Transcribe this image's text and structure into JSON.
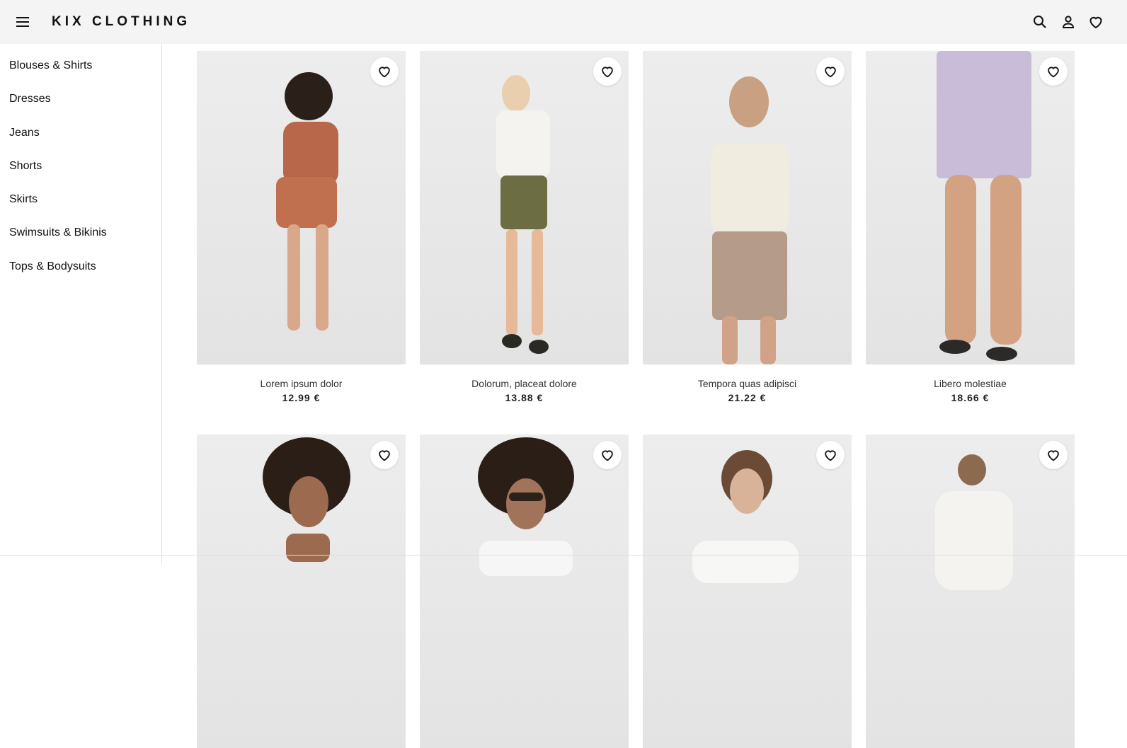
{
  "header": {
    "brand": "KIX CLOTHING",
    "icons": {
      "menu": "menu-icon",
      "search": "search-icon",
      "account": "account-icon",
      "wishlist": "heart-icon"
    }
  },
  "sidebar": {
    "items": [
      {
        "label": "Blouses & Shirts"
      },
      {
        "label": "Dresses"
      },
      {
        "label": "Jeans"
      },
      {
        "label": "Shorts"
      },
      {
        "label": "Skirts"
      },
      {
        "label": "Swimsuits & Bikinis"
      },
      {
        "label": "Tops & Bodysuits"
      }
    ]
  },
  "products": [
    {
      "title": "Lorem ipsum dolor",
      "price": "12.99 €"
    },
    {
      "title": "Dolorum, placeat dolore",
      "price": "13.88 €"
    },
    {
      "title": "Tempora quas adipisci",
      "price": "21.22 €"
    },
    {
      "title": "Libero molestiae",
      "price": "18.66 €"
    },
    {
      "title": "",
      "price": ""
    },
    {
      "title": "",
      "price": ""
    },
    {
      "title": "",
      "price": ""
    },
    {
      "title": "",
      "price": ""
    }
  ],
  "colors": {
    "header_bg": "#f4f4f4",
    "photo_bg": "#e8e8e8",
    "text": "#111111"
  }
}
